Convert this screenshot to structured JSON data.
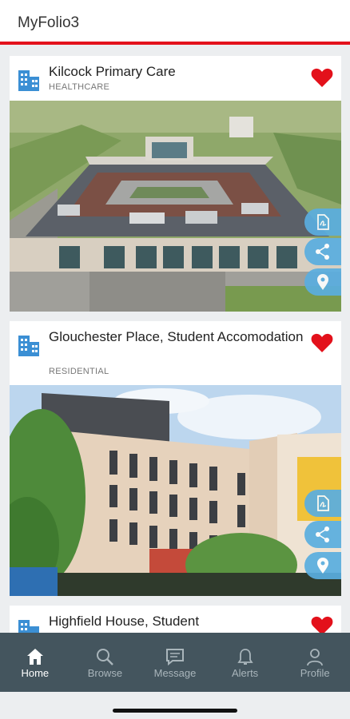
{
  "app": {
    "title": "MyFolio3"
  },
  "colors": {
    "accent": "#e3111b",
    "brand_blue": "#3b8fd4",
    "nav_bg": "#44555e"
  },
  "projects": [
    {
      "name": "Kilcock Primary Care",
      "category": "HEALTHCARE",
      "favorited": true,
      "icon": "building-icon",
      "actions": [
        "pdf-icon",
        "share-icon",
        "location-pin-icon"
      ]
    },
    {
      "name": "Glouchester Place, Student Accomodation",
      "category": "RESIDENTIAL",
      "favorited": true,
      "icon": "building-icon",
      "actions": [
        "pdf-icon",
        "share-icon",
        "location-pin-icon"
      ]
    },
    {
      "name": "Highfield House, Student",
      "category": "",
      "favorited": true,
      "icon": "building-icon"
    }
  ],
  "nav": {
    "items": [
      {
        "label": "Home",
        "icon": "home-icon",
        "active": true
      },
      {
        "label": "Browse",
        "icon": "search-icon",
        "active": false
      },
      {
        "label": "Message",
        "icon": "message-icon",
        "active": false
      },
      {
        "label": "Alerts",
        "icon": "bell-icon",
        "active": false
      },
      {
        "label": "Profile",
        "icon": "profile-icon",
        "active": false
      }
    ]
  }
}
